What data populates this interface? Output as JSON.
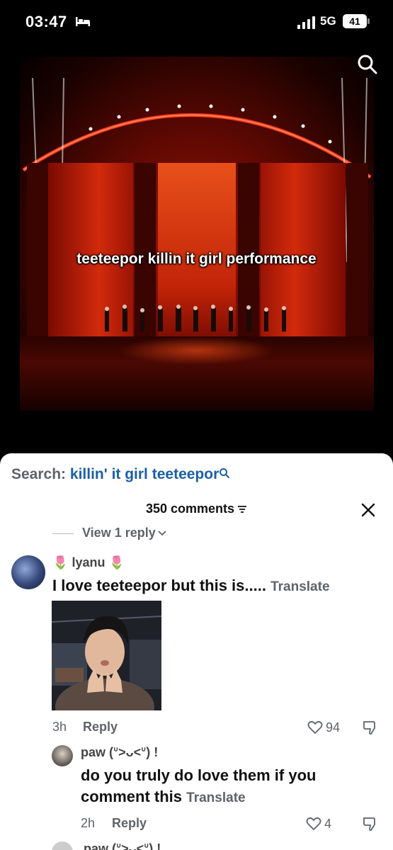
{
  "status_bar": {
    "time": "03:47",
    "network": "5G",
    "battery": "41"
  },
  "video": {
    "caption": "teeteepor killin it girl performance"
  },
  "search": {
    "label": "Search:",
    "query": "killin' it girl teeteepor"
  },
  "comments": {
    "count_label": "350 comments",
    "view_reply": "View 1 reply",
    "main": {
      "user_left_emoji": "🌷",
      "user": "lyanu",
      "user_right_emoji": "🌷",
      "text": "I love teeteepor but this is.....",
      "translate": "Translate",
      "time": "3h",
      "reply_label": "Reply",
      "likes": "94"
    },
    "reply": {
      "user": "paw (ᐡ˃ᴗ˂ᐡ) !",
      "text_line1": "do you truly do love them if you",
      "text_line2": "comment this",
      "translate": "Translate",
      "time": "2h",
      "reply_label": "Reply",
      "likes": "4"
    },
    "next_user": "paw (ᐡ˃ᴗ˂ᐡ) !"
  },
  "colors": {
    "search_query": "#1a5fa8",
    "muted": "#5f6368"
  }
}
